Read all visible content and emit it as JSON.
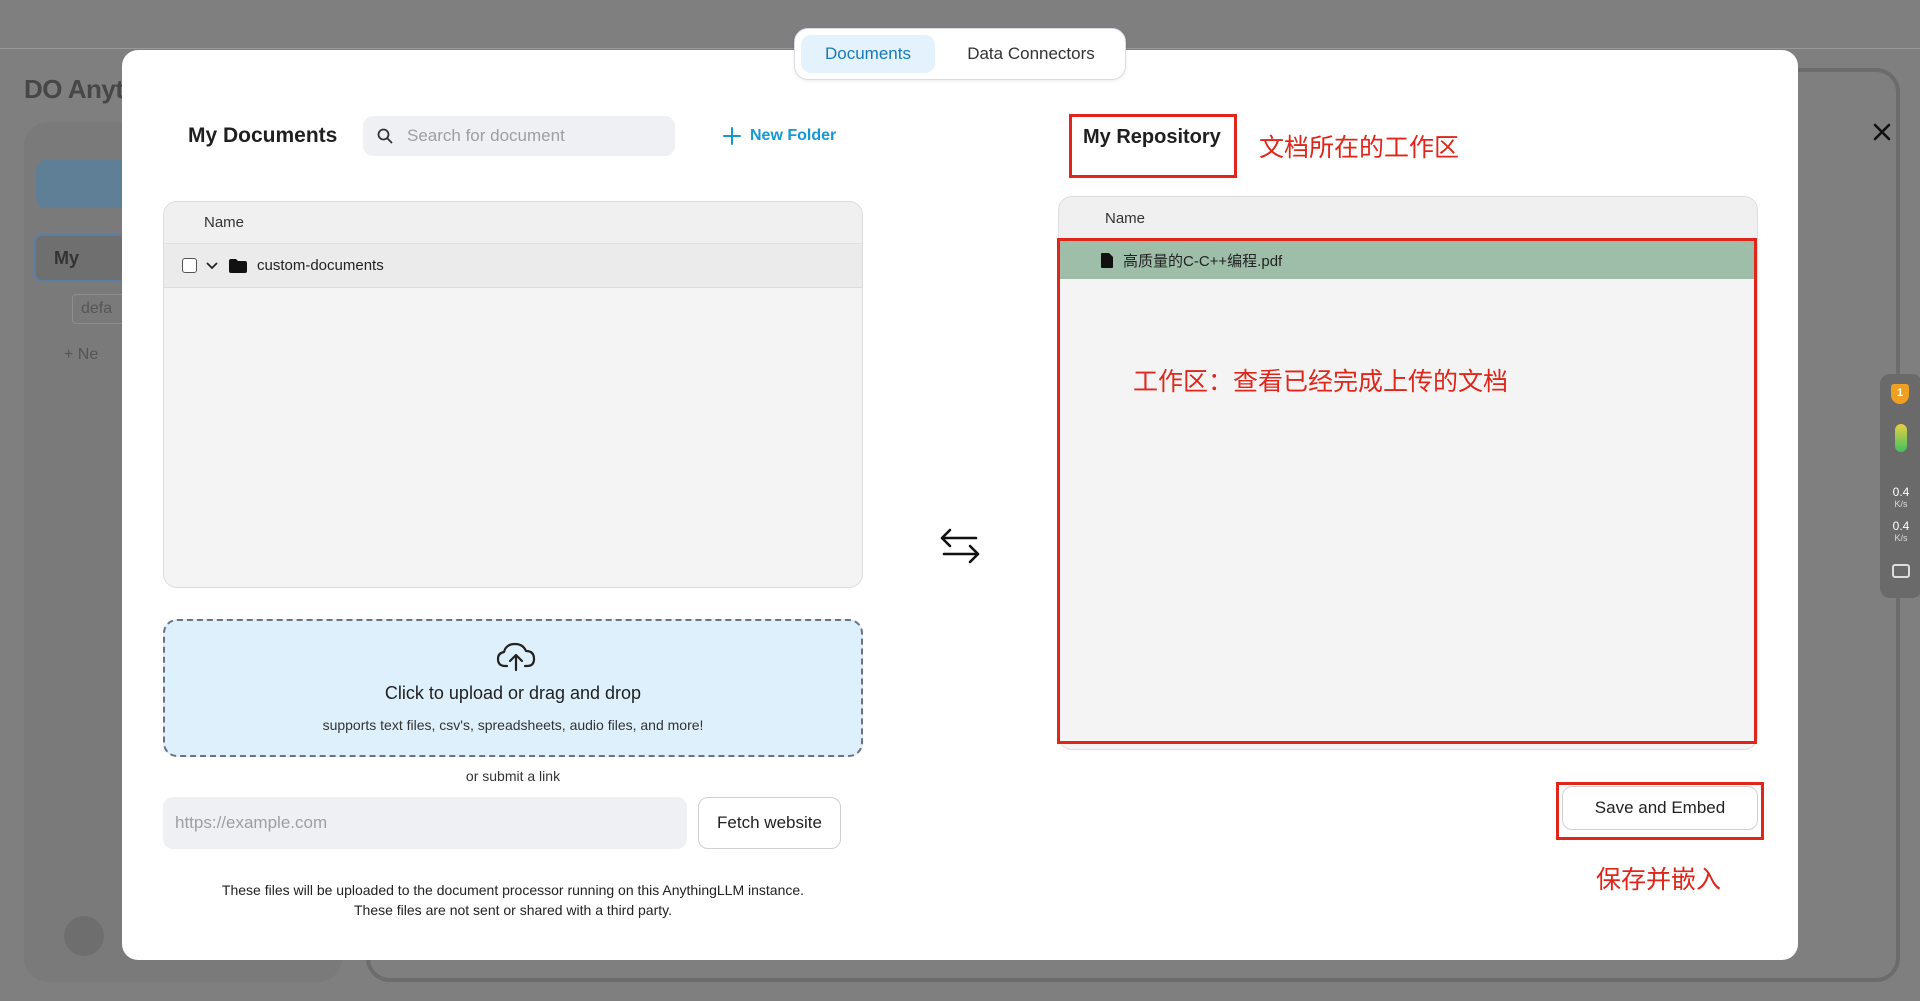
{
  "background": {
    "brand": "DO Anyth",
    "workspace_label": "My",
    "thread_label": "defa",
    "new_label": "+  Ne"
  },
  "side_widget": {
    "badge": "1",
    "upload_speed": "0.4",
    "upload_unit": "K/s",
    "download_speed": "0.4",
    "download_unit": "K/s"
  },
  "tabs": [
    {
      "label": "Documents",
      "active": true
    },
    {
      "label": "Data Connectors",
      "active": false
    }
  ],
  "documents": {
    "title": "My Documents",
    "search_placeholder": "Search for document",
    "new_folder_label": "New Folder",
    "table_header": "Name",
    "folders": [
      {
        "name": "custom-documents",
        "expanded": true,
        "checked": false
      }
    ]
  },
  "upload": {
    "title": "Click to upload or drag and drop",
    "subtitle": "supports text files, csv's, spreadsheets, audio files, and more!",
    "or_link": "or submit a link",
    "url_placeholder": "https://example.com",
    "fetch_button": "Fetch website",
    "note_line1": "These files will be uploaded to the document processor running on this AnythingLLM instance.",
    "note_line2": "These files are not sent or shared with a third party."
  },
  "repository": {
    "title": "My Repository",
    "table_header": "Name",
    "files": [
      {
        "name": "高质量的C-C++编程.pdf"
      }
    ],
    "save_button": "Save and Embed"
  },
  "annotations": {
    "repository_label": "文档所在的工作区",
    "workspace_label": "工作区：查看已经完成上传的文档",
    "save_label": "保存并嵌入"
  },
  "colors": {
    "accent": "#1598d6",
    "active_tab_bg": "#e3f2fc",
    "selected_file_bg": "#9fbeaa",
    "annotation_red": "#e0251a",
    "upload_zone_bg": "#def0fb"
  }
}
